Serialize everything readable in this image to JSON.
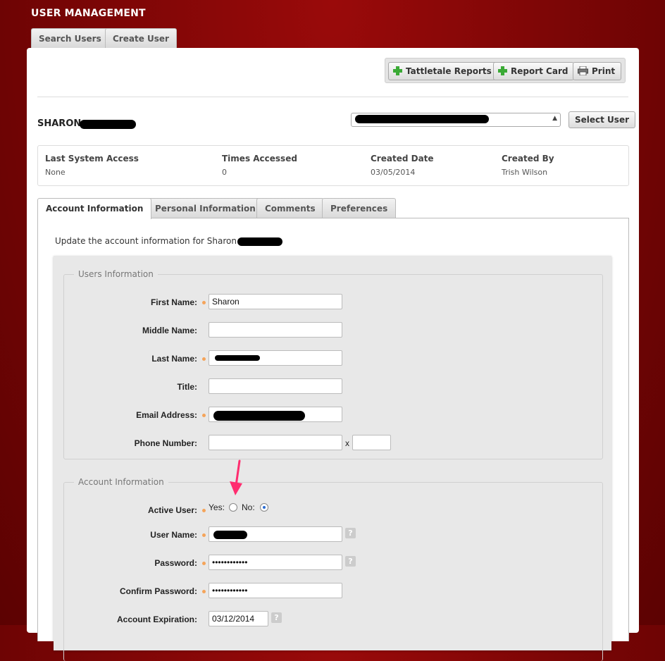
{
  "app": {
    "title": "USER MANAGEMENT"
  },
  "top_tabs": [
    {
      "label": "Search Users"
    },
    {
      "label": "Create User"
    }
  ],
  "toolbar": {
    "tattletale_label": "Tattletale Reports",
    "report_card_label": "Report Card",
    "print_label": "Print"
  },
  "user": {
    "name": "SHARON"
  },
  "select_user_label": "Select User",
  "stats": {
    "headers": [
      "Last System Access",
      "Times Accessed",
      "Created Date",
      "Created By"
    ],
    "values": [
      "None",
      "0",
      "03/05/2014",
      "Trish Wilson"
    ]
  },
  "tabs": [
    {
      "label": "Account Information"
    },
    {
      "label": "Personal Information"
    },
    {
      "label": "Comments"
    },
    {
      "label": "Preferences"
    }
  ],
  "intro": "Update the account information for Sharon",
  "users_info": {
    "legend": "Users Information",
    "first_name_label": "First Name:",
    "first_name_value": "Sharon",
    "middle_name_label": "Middle Name:",
    "last_name_label": "Last Name:",
    "title_label": "Title:",
    "email_label": "Email Address:",
    "phone_label": "Phone Number:",
    "phone_ext_sep": "x"
  },
  "account_info": {
    "legend": "Account Information",
    "active_label": "Active User:",
    "yes_label": "Yes:",
    "no_label": "No:",
    "username_label": "User Name:",
    "password_label": "Password:",
    "password_value": "••••••••••••",
    "confirm_label": "Confirm Password:",
    "confirm_value": "••••••••••••",
    "expiration_label": "Account Expiration:",
    "expiration_value": "03/12/2014",
    "help_glyph": "?"
  },
  "colors": {
    "brand_red": "#8b0000",
    "required_dot": "#f5a45a",
    "annotation_arrow": "#ff2d6f",
    "add_green": "#3aaa35"
  }
}
